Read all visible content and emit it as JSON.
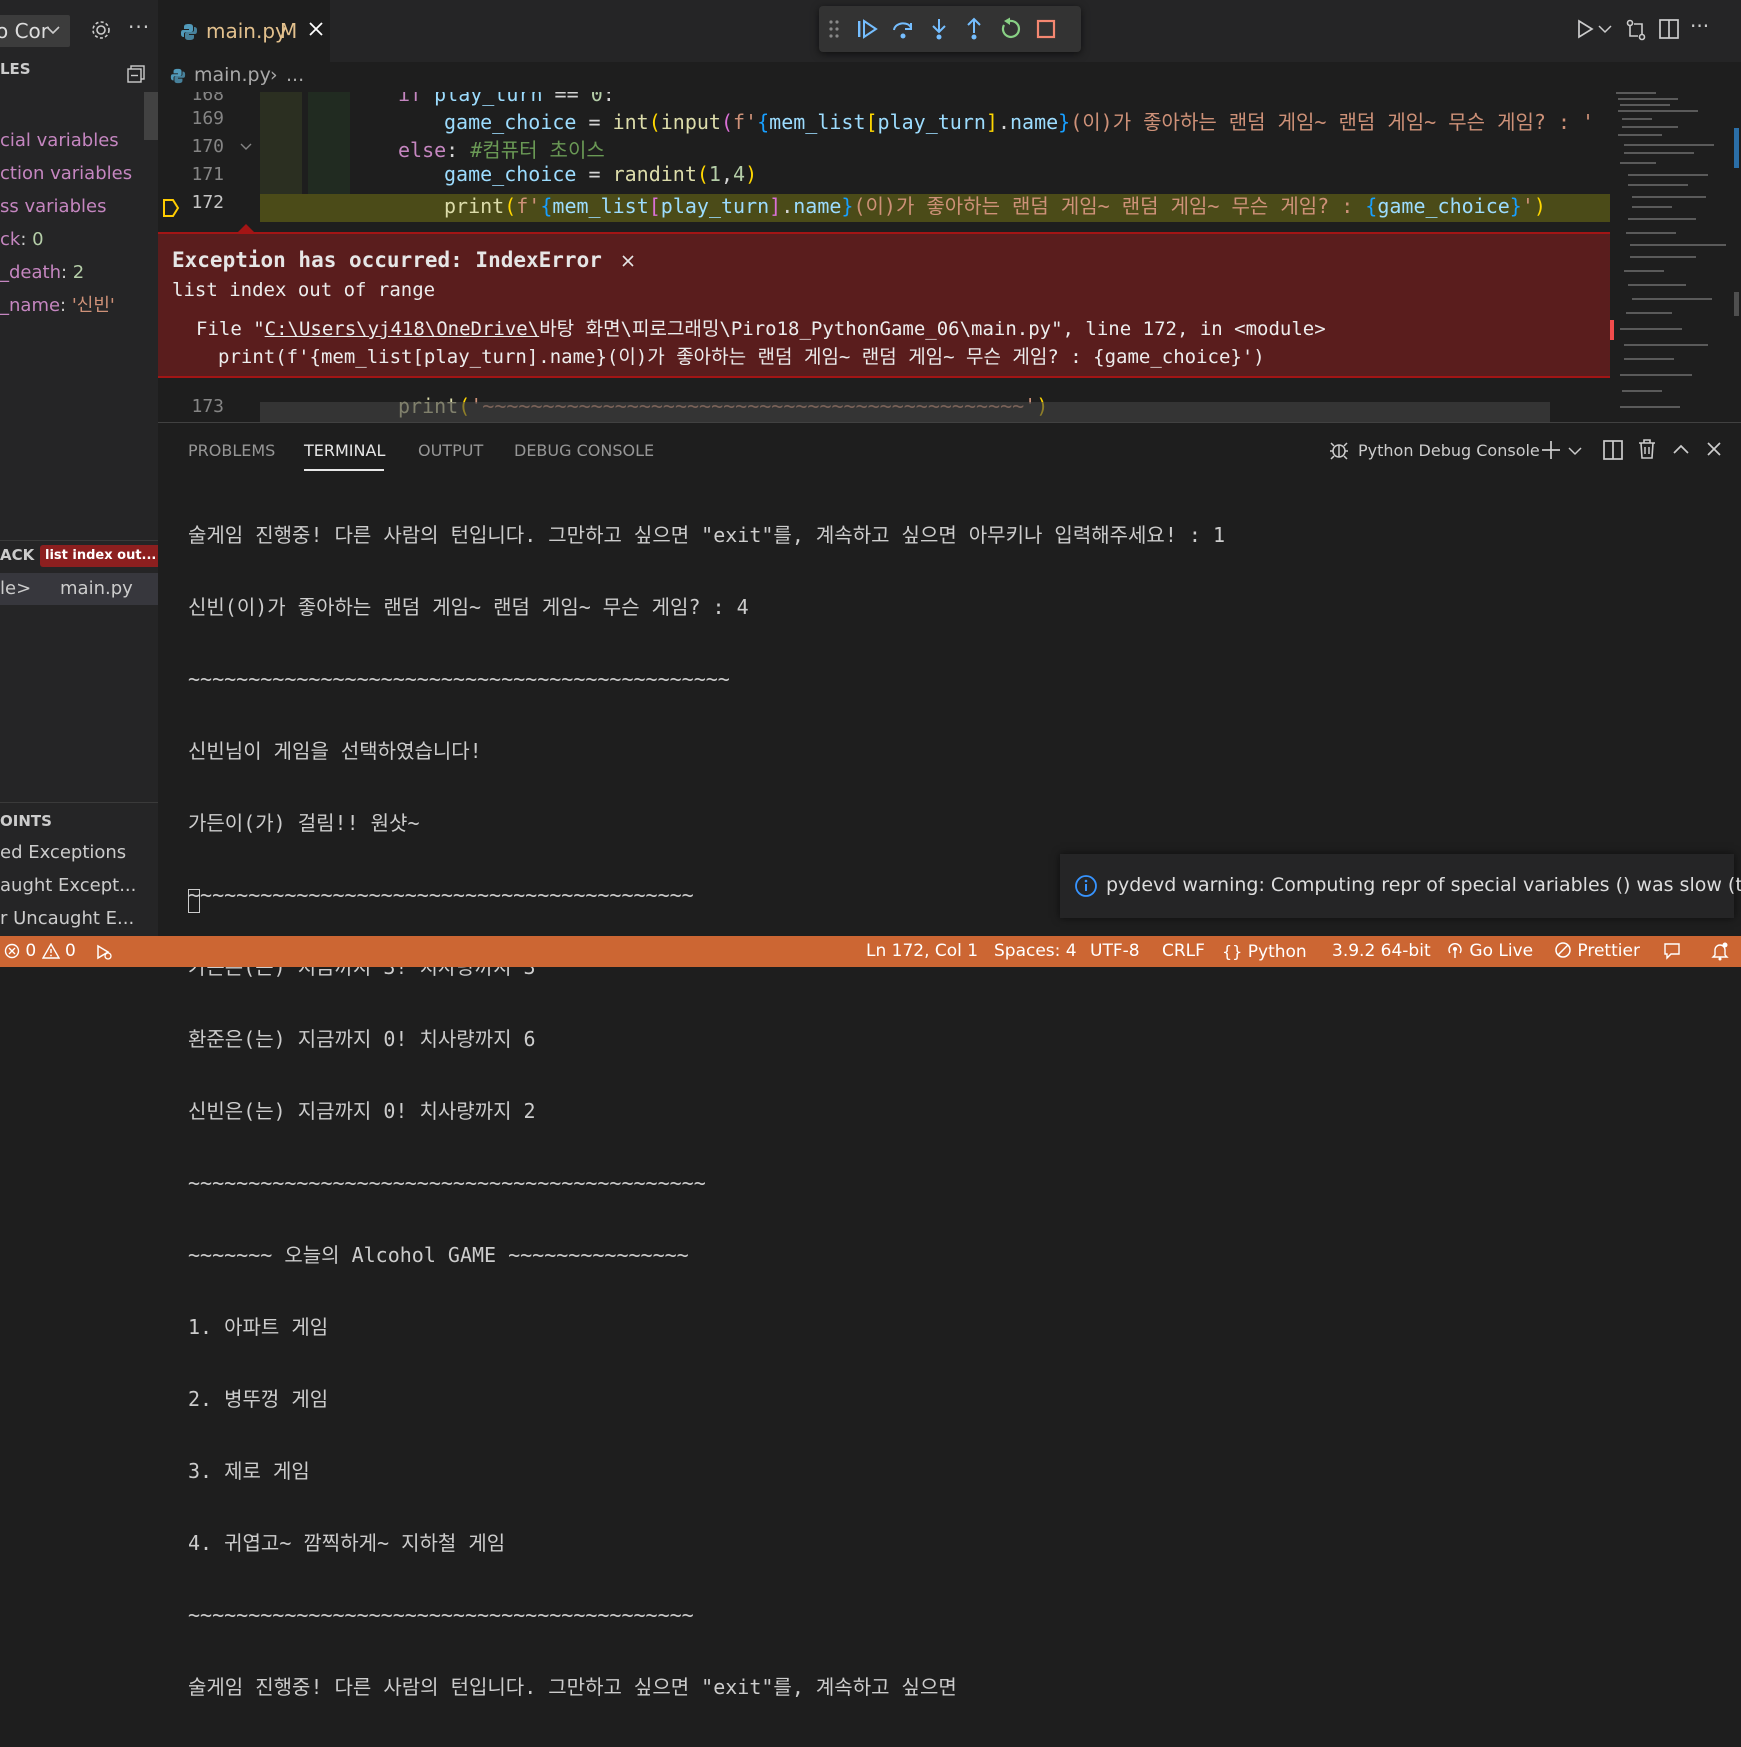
{
  "sidebar": {
    "config_name": "o Cor",
    "variables_header": "LES",
    "variables": [
      {
        "key": "cial variables",
        "value": ""
      },
      {
        "key": "ction variables",
        "value": ""
      },
      {
        "key": "ss variables",
        "value": ""
      },
      {
        "key": "ck",
        "sep": ": ",
        "value": "0"
      },
      {
        "key": "_death",
        "sep": ": ",
        "value": "2"
      },
      {
        "key": "_name",
        "sep": ": ",
        "value": "'신빈'"
      }
    ],
    "call_stack_header": "ACK",
    "call_stack_badge": "list index out...",
    "stack_frame": {
      "module": "le>",
      "file": "main.py"
    },
    "breakpoints_header": "OINTS",
    "breakpoints": [
      "ed Exceptions",
      "aught Except...",
      "r Uncaught E..."
    ]
  },
  "editor": {
    "tab": {
      "name": "main.py",
      "mark": "M"
    },
    "breadcrumb": {
      "file": "main.py",
      "rest": "..."
    },
    "lines": [
      {
        "n": "168"
      },
      {
        "n": "169"
      },
      {
        "n": "170"
      },
      {
        "n": "171"
      },
      {
        "n": "172"
      },
      {
        "n": "173"
      }
    ],
    "exception": {
      "title": "Exception has occurred: IndexError",
      "message": "list index out of range",
      "file_prefix": "File \"",
      "file_link": "C:\\Users\\yj418\\OneDrive\\",
      "file_rest": "바탕 화면\\피로그래밍\\Piro18_PythonGame_06\\main.py\", line 172, in <module>",
      "source": "print(f'{mem_list[play_turn].name}(이)가 좋아하는 랜덤 게임~ 랜덤 게임~ 무슨 게임? : {game_choice}')"
    }
  },
  "panel": {
    "tabs": [
      "PROBLEMS",
      "TERMINAL",
      "OUTPUT",
      "DEBUG CONSOLE"
    ],
    "active_tab": "TERMINAL",
    "console_name": "Python Debug Console",
    "terminal_lines": [
      "술게임 진행중! 다른 사람의 턴입니다. 그만하고 싶으면 \"exit\"를, 계속하고 싶으면 아무키나 입력해주세요! : 1",
      "신빈(이)가 좋아하는 랜덤 게임~ 랜덤 게임~ 무슨 게임? : 4",
      "~~~~~~~~~~~~~~~~~~~~~~~~~~~~~~~~~~~~~~~~~~~~~",
      "신빈님이 게임을 선택하였습니다!",
      "가든이(가) 걸림!! 원샷~",
      "~~~~~~~~~~~~~~~~~~~~~~~~~~~~~~~~~~~~~~~~~~",
      "가든은(는) 지금까지 3! 치사량까지 3",
      "환준은(는) 지금까지 0! 치사량까지 6",
      "신빈은(는) 지금까지 0! 치사량까지 2",
      "~~~~~~~~~~~~~~~~~~~~~~~~~~~~~~~~~~~~~~~~~~~",
      "~~~~~~~ 오늘의 Alcohol GAME ~~~~~~~~~~~~~~~",
      "1. 아파트 게임",
      "2. 병뚜껑 게임",
      "3. 제로 게임",
      "4. 귀엽고~ 깜찍하게~ 지하철 게임",
      "~~~~~~~~~~~~~~~~~~~~~~~~~~~~~~~~~~~~~~~~~~",
      "술게임 진행중! 다른 사람의 턴입니다. 그만하고 싶으면 \"exit\"를, 계속하고 싶으면 "
    ]
  },
  "notification": {
    "text": "pydevd warning: Computing repr of special variables () was slow (took ..."
  },
  "status": {
    "errors": "0",
    "warnings": "0",
    "position": "Ln 172, Col 1",
    "spaces": "Spaces: 4",
    "encoding": "UTF-8",
    "eol": "CRLF",
    "language": "Python",
    "interpreter": "3.9.2 64-bit",
    "golive": "Go Live",
    "prettier": "Prettier"
  },
  "colors": {
    "status_bar": "#cc6633",
    "exception_bg": "#5a1d1d",
    "current_line": "#4b4b18"
  }
}
